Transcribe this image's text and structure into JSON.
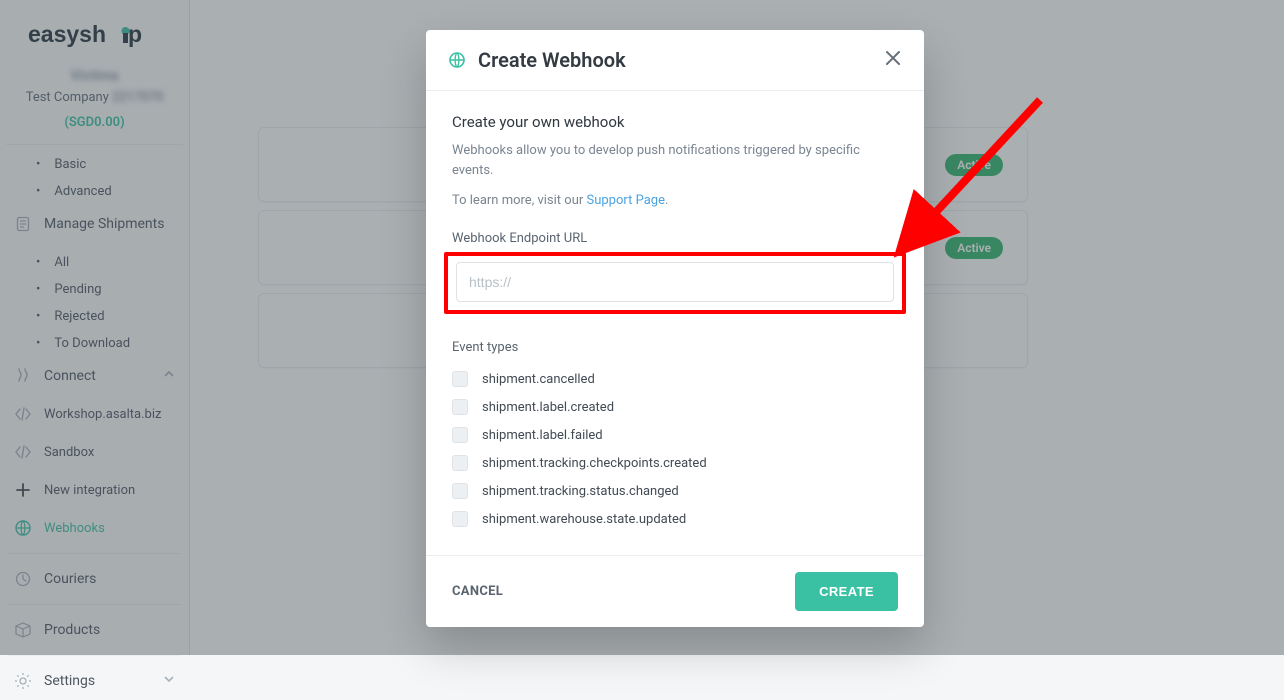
{
  "logo_text": "easyship",
  "account": {
    "name_blur": "Victima",
    "company_prefix": "Test Company",
    "company_blur": "2217070",
    "balance": "(SGD0.00)"
  },
  "sidebar": {
    "quotes": {
      "items": [
        {
          "label": "Basic"
        },
        {
          "label": "Advanced"
        }
      ]
    },
    "manage": {
      "label": "Manage Shipments",
      "items": [
        {
          "label": "All"
        },
        {
          "label": "Pending"
        },
        {
          "label": "Rejected"
        },
        {
          "label": "To Download"
        }
      ]
    },
    "connect": {
      "label": "Connect"
    },
    "integrations": [
      {
        "label": "Workshop.asalta.biz"
      },
      {
        "label": "Sandbox"
      }
    ],
    "new_integration": "New integration",
    "webhooks": "Webhooks",
    "couriers": "Couriers",
    "products": "Products",
    "settings": "Settings"
  },
  "badges": {
    "active": "Active"
  },
  "modal": {
    "title": "Create Webhook",
    "subtitle": "Create your own webhook",
    "desc": "Webhooks allow you to develop push notifications triggered by specific events.",
    "learn_prefix": "To learn more, visit our ",
    "learn_link": "Support Page",
    "learn_suffix": ".",
    "url_label": "Webhook Endpoint URL",
    "url_placeholder": "https://",
    "event_label": "Event types",
    "events": [
      "shipment.cancelled",
      "shipment.label.created",
      "shipment.label.failed",
      "shipment.tracking.checkpoints.created",
      "shipment.tracking.status.changed",
      "shipment.warehouse.state.updated"
    ],
    "cancel": "CANCEL",
    "create": "CREATE"
  }
}
